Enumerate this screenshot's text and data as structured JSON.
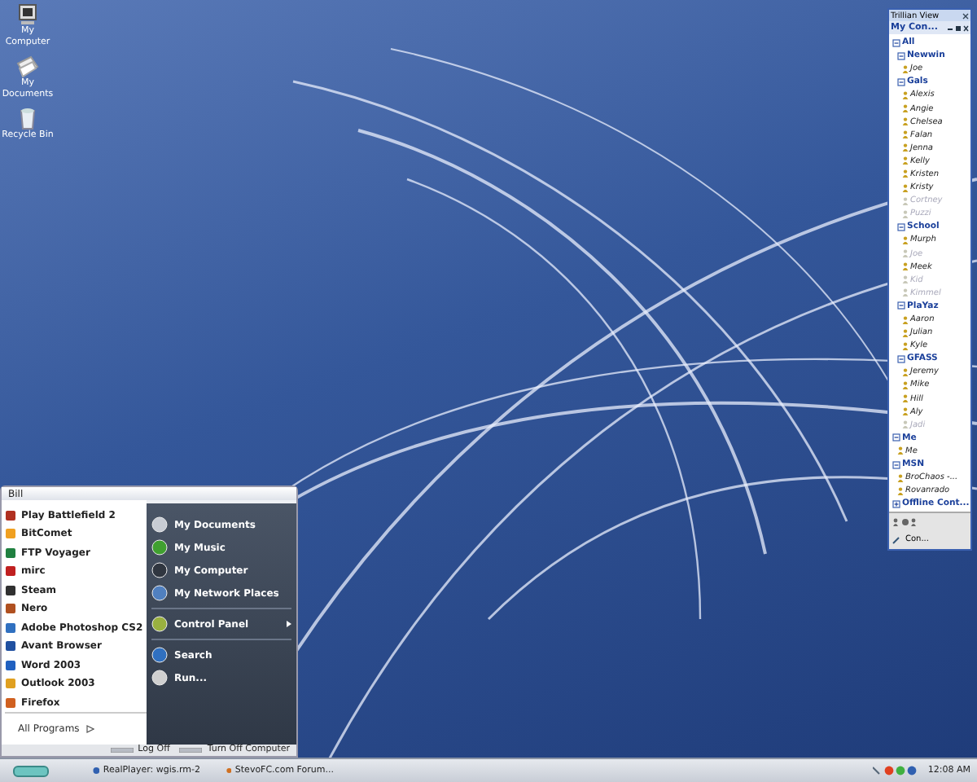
{
  "desktop_icons": [
    {
      "label": "My Computer"
    },
    {
      "label": "My Documents"
    },
    {
      "label": "Recycle Bin"
    }
  ],
  "trillian": {
    "title": "Trillian View",
    "header": "My Con...",
    "tree": [
      {
        "kind": "group",
        "label": "All",
        "expanded": true,
        "children": [
          {
            "kind": "group",
            "label": "Newwin",
            "expanded": true,
            "children": [
              {
                "kind": "contact",
                "label": "Joe",
                "online": true
              }
            ]
          },
          {
            "kind": "group",
            "label": "Gals",
            "expanded": true,
            "children": [
              {
                "kind": "contact",
                "label": "Alexis",
                "online": true
              },
              {
                "kind": "contact",
                "label": "Angie",
                "online": true
              },
              {
                "kind": "contact",
                "label": "Chelsea",
                "online": true
              },
              {
                "kind": "contact",
                "label": "Falan",
                "online": true
              },
              {
                "kind": "contact",
                "label": "Jenna",
                "online": true
              },
              {
                "kind": "contact",
                "label": "Kelly",
                "online": true
              },
              {
                "kind": "contact",
                "label": "Kristen",
                "online": true
              },
              {
                "kind": "contact",
                "label": "Kristy",
                "online": true
              },
              {
                "kind": "contact",
                "label": "Cortney",
                "online": false
              },
              {
                "kind": "contact",
                "label": "Puzzi",
                "online": false
              }
            ]
          },
          {
            "kind": "group",
            "label": "School",
            "expanded": true,
            "children": [
              {
                "kind": "contact",
                "label": "Murph",
                "online": true
              },
              {
                "kind": "contact",
                "label": "Joe",
                "online": false
              },
              {
                "kind": "contact",
                "label": "Meek",
                "online": true
              },
              {
                "kind": "contact",
                "label": "Kid",
                "online": false
              },
              {
                "kind": "contact",
                "label": "Kimmel",
                "online": false
              }
            ]
          },
          {
            "kind": "group",
            "label": "PlaYaz",
            "expanded": true,
            "children": [
              {
                "kind": "contact",
                "label": "Aaron",
                "online": true
              },
              {
                "kind": "contact",
                "label": "Julian",
                "online": true
              },
              {
                "kind": "contact",
                "label": "Kyle",
                "online": true
              }
            ]
          },
          {
            "kind": "group",
            "label": "GFASS",
            "expanded": true,
            "children": [
              {
                "kind": "contact",
                "label": "Jeremy",
                "online": true
              },
              {
                "kind": "contact",
                "label": "Mike",
                "online": true
              },
              {
                "kind": "contact",
                "label": "Hill",
                "online": true
              },
              {
                "kind": "contact",
                "label": "Aly",
                "online": true
              },
              {
                "kind": "contact",
                "label": "Jadi",
                "online": false
              }
            ]
          }
        ]
      },
      {
        "kind": "group",
        "label": "Me",
        "expanded": true,
        "children": [
          {
            "kind": "contact",
            "label": "Me",
            "online": true
          }
        ]
      },
      {
        "kind": "group",
        "label": "MSN",
        "expanded": true,
        "children": [
          {
            "kind": "contact",
            "label": "BroChaos -...",
            "online": true
          },
          {
            "kind": "contact",
            "label": "Rovanrado",
            "online": true
          }
        ]
      },
      {
        "kind": "group",
        "label": "Offline Cont...",
        "expanded": false
      }
    ],
    "footer": "Con..."
  },
  "start_menu": {
    "user": "Bill",
    "programs": [
      "Play Battlefield 2",
      "BitComet",
      "FTP Voyager",
      "mirc",
      "Steam",
      "Nero",
      "Adobe Photoshop CS2",
      "Avant Browser",
      "Word 2003",
      "Outlook 2003",
      "Firefox"
    ],
    "all_programs": "All Programs",
    "place_sections": [
      {
        "items": [
          {
            "label": "My Documents",
            "has_submenu": false
          },
          {
            "label": "My Music",
            "has_submenu": false
          },
          {
            "label": "My Computer",
            "has_submenu": false
          },
          {
            "label": "My Network Places",
            "has_submenu": false
          }
        ]
      },
      {
        "items": [
          {
            "label": "Control Panel",
            "has_submenu": true
          }
        ]
      },
      {
        "items": [
          {
            "label": "Search",
            "has_submenu": false
          },
          {
            "label": "Run...",
            "has_submenu": false
          }
        ]
      }
    ],
    "log_off": "Log Off",
    "turn_off": "Turn Off Computer"
  },
  "taskbar": {
    "tasks": [
      {
        "label": "RealPlayer: wgis.rm-2",
        "selected": false
      },
      {
        "label": "StevoFC.com Forum...",
        "selected": false
      }
    ],
    "clock": "12:08 AM"
  }
}
